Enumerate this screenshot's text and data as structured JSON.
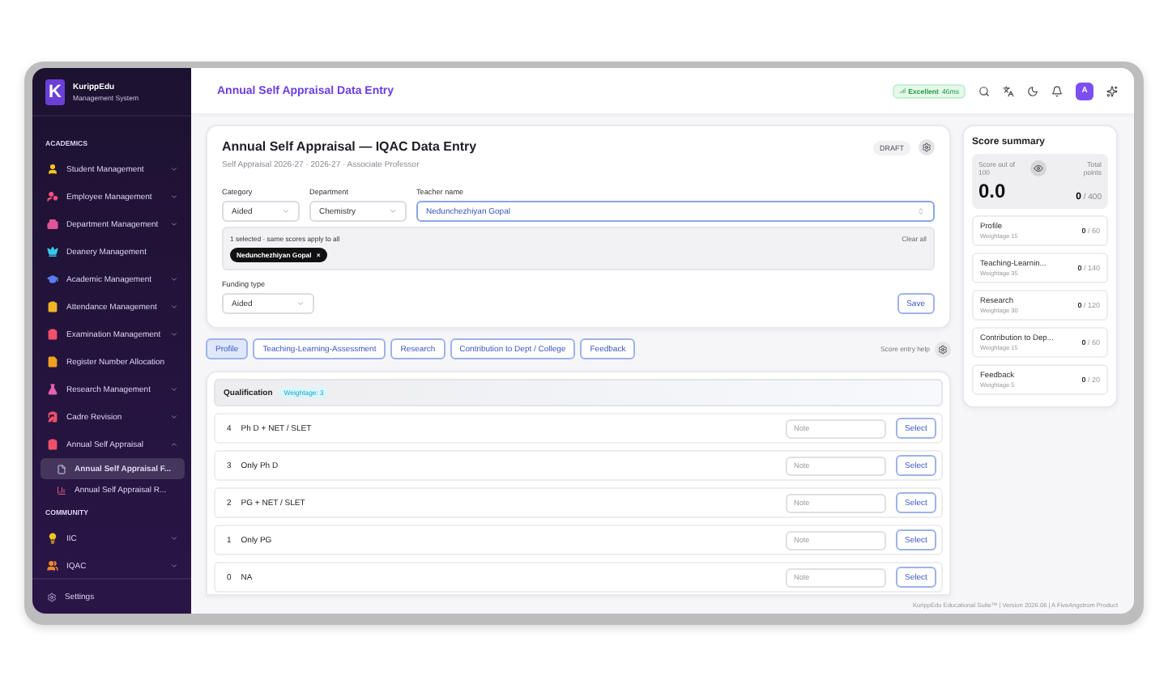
{
  "brand": {
    "logo": "K",
    "name": "KurippEdu",
    "subtitle": "Management System"
  },
  "sidebar": {
    "sections": [
      {
        "title": "ACADEMICS",
        "items": [
          {
            "label": "Student Management",
            "color": "#f5c518",
            "expanded": false
          },
          {
            "label": "Employee Management",
            "color": "#f0507a",
            "expanded": false
          },
          {
            "label": "Department Management",
            "color": "#e2559a",
            "expanded": false
          },
          {
            "label": "Deanery Management",
            "color": "#38c6e8"
          },
          {
            "label": "Academic Management",
            "color": "#5b7cf0",
            "expanded": false
          },
          {
            "label": "Attendance Management",
            "color": "#f0b429",
            "expanded": false
          },
          {
            "label": "Examination Management",
            "color": "#f0506a",
            "expanded": false
          },
          {
            "label": "Register Number Allocation",
            "color": "#f0a020"
          },
          {
            "label": "Research Management",
            "color": "#e860b0",
            "expanded": false
          },
          {
            "label": "Cadre Revision",
            "color": "#f0506a",
            "expanded": false
          },
          {
            "label": "Annual Self Appraisal",
            "color": "#f0506a",
            "expanded": true,
            "children": [
              {
                "label": "Annual Self Appraisal F...",
                "selected": true
              },
              {
                "label": "Annual Self Appraisal R...",
                "selected": false
              }
            ]
          }
        ]
      },
      {
        "title": "COMMUNITY",
        "items": [
          {
            "label": "IIC",
            "color": "#f5c518",
            "expanded": false
          },
          {
            "label": "IQAC",
            "color": "#f08a30",
            "expanded": false
          }
        ]
      }
    ],
    "footer": "Settings"
  },
  "header": {
    "title": "Annual Self Appraisal Data Entry",
    "network": {
      "label": "Excellent",
      "latency": "46ms"
    },
    "avatar": "A"
  },
  "form": {
    "title": "Annual Self Appraisal — IQAC Data Entry",
    "subtitle": "Self Appraisal 2026-27 · 2026-27 · Associate Professor",
    "status": "DRAFT",
    "category": {
      "label": "Category",
      "value": "Aided"
    },
    "department": {
      "label": "Department",
      "value": "Chemistry"
    },
    "teacher": {
      "label": "Teacher name",
      "value": "Nedunchezhiyan Gopal"
    },
    "selection": {
      "summary": "1 selected · same scores apply to all",
      "clear": "Clear all",
      "chips": [
        {
          "label": "Nedunchezhiyan Gopal",
          "remove": "×"
        }
      ]
    },
    "funding": {
      "label": "Funding type",
      "value": "Aided"
    },
    "save": "Save"
  },
  "tabs": [
    {
      "label": "Profile",
      "selected": true
    },
    {
      "label": "Teaching-Learning-Assessment",
      "selected": false
    },
    {
      "label": "Research",
      "selected": false
    },
    {
      "label": "Contribution to Dept / College",
      "selected": false
    },
    {
      "label": "Feedback",
      "selected": false
    }
  ],
  "help": "Score entry help",
  "qualification": {
    "title": "Qualification",
    "weightage": "Weightage: 3",
    "rows": [
      {
        "score": "4",
        "label": "Ph D + NET / SLET",
        "placeholder": "Note",
        "action": "Select"
      },
      {
        "score": "3",
        "label": "Only Ph D",
        "placeholder": "Note",
        "action": "Select"
      },
      {
        "score": "2",
        "label": "PG + NET / SLET",
        "placeholder": "Note",
        "action": "Select"
      },
      {
        "score": "1",
        "label": "Only PG",
        "placeholder": "Note",
        "action": "Select"
      },
      {
        "score": "0",
        "label": "NA",
        "placeholder": "Note",
        "action": "Select"
      }
    ]
  },
  "summary": {
    "title": "Score summary",
    "score_label": "Score out of 100",
    "score": "0.0",
    "total_label": "Total points",
    "total": "0",
    "total_max": "/ 400",
    "items": [
      {
        "name": "Profile",
        "weightage": "Weightage 15",
        "score": "0",
        "max": "/ 60"
      },
      {
        "name": "Teaching-Learnin...",
        "weightage": "Weightage 35",
        "score": "0",
        "max": "/ 140"
      },
      {
        "name": "Research",
        "weightage": "Weightage 30",
        "score": "0",
        "max": "/ 120"
      },
      {
        "name": "Contribution to Dep...",
        "weightage": "Weightage 15",
        "score": "0",
        "max": "/ 60"
      },
      {
        "name": "Feedback",
        "weightage": "Weightage 5",
        "score": "0",
        "max": "/ 20"
      }
    ]
  },
  "footer": "KurippEdu Educational Suite™ | Version 2026.06 | A FiveAngstrom Product"
}
